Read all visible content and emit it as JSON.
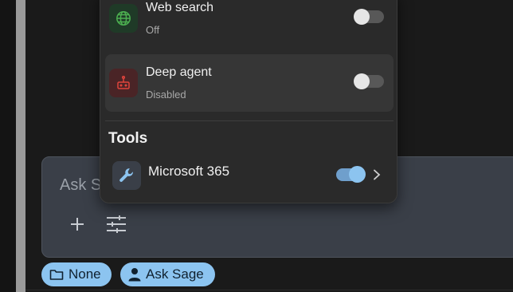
{
  "chat": {
    "placeholder": "Ask Sage"
  },
  "chips": [
    {
      "label": "None",
      "icon": "folder-icon"
    },
    {
      "label": "Ask Sage",
      "icon": "person-icon"
    }
  ],
  "popup": {
    "rows": [
      {
        "title": "Web search",
        "subtitle": "Off",
        "icon": "globe-icon",
        "enabled": false
      },
      {
        "title": "Deep agent",
        "subtitle": "Disabled",
        "icon": "robot-icon",
        "enabled": false
      }
    ],
    "tools_title": "Tools",
    "tools": [
      {
        "label": "Microsoft 365",
        "icon": "wrench-icon",
        "enabled": true
      }
    ]
  },
  "colors": {
    "accent": "#8cc4f0",
    "background": "#1a1a1a",
    "popup": "#2a2a2a",
    "input": "#3a3f48",
    "deep_agent_icon": "#e0443c",
    "web_search_icon": "#4caf50"
  }
}
